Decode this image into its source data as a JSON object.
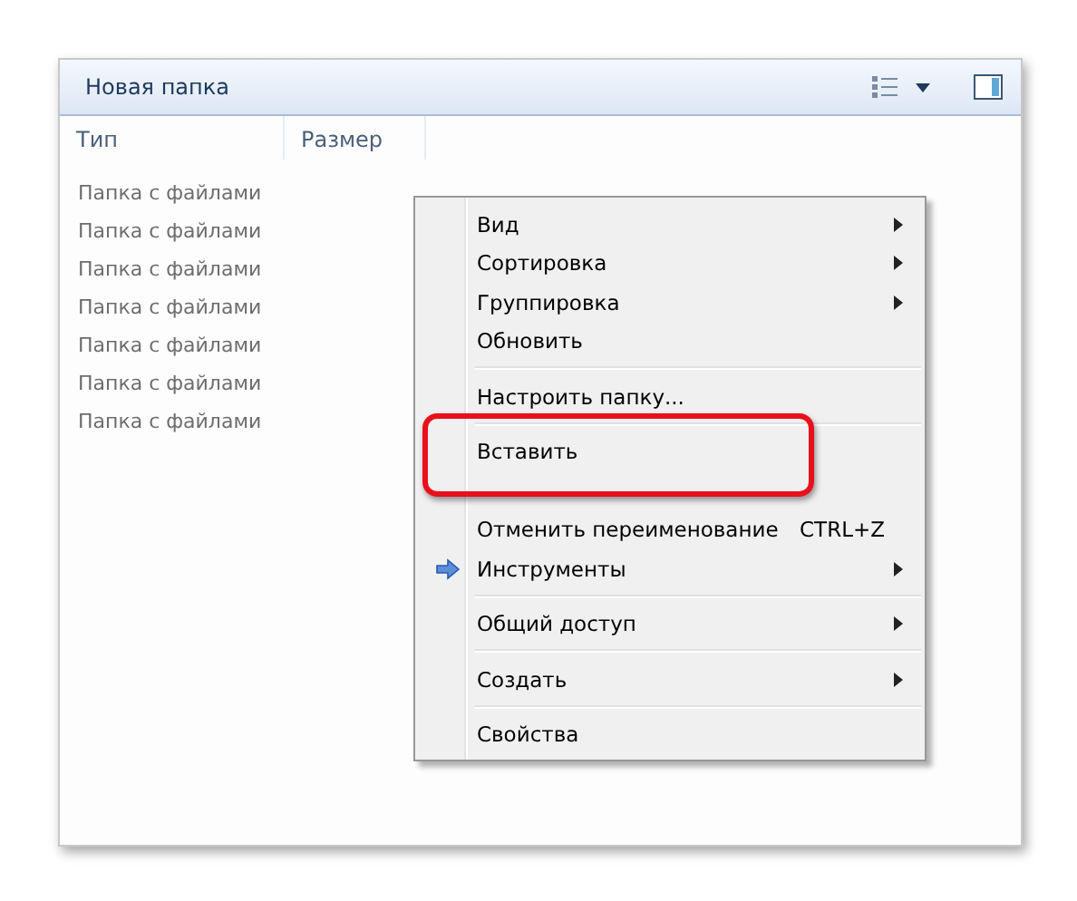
{
  "window": {
    "title": "Новая папка"
  },
  "columns": [
    "Тип",
    "Размер"
  ],
  "rows": [
    "Папка с файлами",
    "Папка с файлами",
    "Папка с файлами",
    "Папка с файлами",
    "Папка с файлами",
    "Папка с файлами",
    "Папка с файлами"
  ],
  "context_menu": {
    "items": [
      {
        "kind": "item",
        "label": "Вид",
        "submenu": true
      },
      {
        "kind": "item",
        "label": "Сортировка",
        "submenu": true
      },
      {
        "kind": "item",
        "label": "Группировка",
        "submenu": true
      },
      {
        "kind": "item",
        "label": "Обновить",
        "submenu": false
      },
      {
        "kind": "separator"
      },
      {
        "kind": "item",
        "label": "Настроить папку...",
        "submenu": false
      },
      {
        "kind": "separator"
      },
      {
        "kind": "item",
        "label": "Вставить",
        "submenu": false,
        "highlighted": true
      },
      {
        "kind": "hidden"
      },
      {
        "kind": "item",
        "label": "Отменить переименование",
        "submenu": false,
        "shortcut": "CTRL+Z"
      },
      {
        "kind": "item",
        "label": "Инструменты",
        "submenu": true,
        "icon": true
      },
      {
        "kind": "separator"
      },
      {
        "kind": "item",
        "label": "Общий доступ",
        "submenu": true
      },
      {
        "kind": "separator"
      },
      {
        "kind": "item",
        "label": "Создать",
        "submenu": true
      },
      {
        "kind": "separator"
      },
      {
        "kind": "item",
        "label": "Свойства",
        "submenu": false
      }
    ]
  }
}
